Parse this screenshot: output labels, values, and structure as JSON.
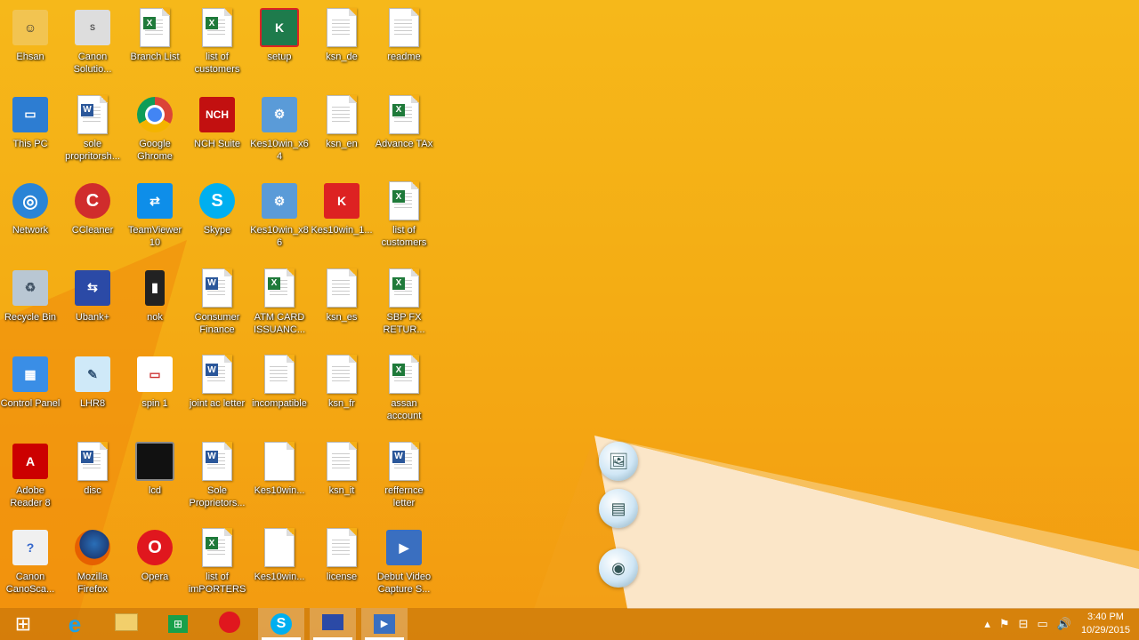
{
  "desktop": {
    "icons": [
      {
        "label": "Ehsan",
        "icon": "user-folder-icon"
      },
      {
        "label": "Canon Solutio...",
        "icon": "canon-solution-icon"
      },
      {
        "label": "Branch List",
        "icon": "excel-file-icon"
      },
      {
        "label": "list of customers",
        "icon": "excel-file-icon"
      },
      {
        "label": "setup",
        "icon": "kaspersky-setup-icon"
      },
      {
        "label": "ksn_de",
        "icon": "text-file-icon"
      },
      {
        "label": "readme",
        "icon": "text-file-icon"
      },
      {
        "label": "This PC",
        "icon": "computer-icon"
      },
      {
        "label": "sole propritorsh...",
        "icon": "word-file-icon"
      },
      {
        "label": "Google Ghrome",
        "icon": "chrome-icon"
      },
      {
        "label": "NCH Suite",
        "icon": "nch-icon"
      },
      {
        "label": "Kes10win_x64",
        "icon": "installer-icon"
      },
      {
        "label": "ksn_en",
        "icon": "text-file-icon"
      },
      {
        "label": "Advance TAx",
        "icon": "excel-file-icon"
      },
      {
        "label": "Network",
        "icon": "network-icon"
      },
      {
        "label": "CCleaner",
        "icon": "ccleaner-icon"
      },
      {
        "label": "TeamViewer 10",
        "icon": "teamviewer-icon"
      },
      {
        "label": "Skype",
        "icon": "skype-icon"
      },
      {
        "label": "Kes10win_x86",
        "icon": "installer-icon"
      },
      {
        "label": "Kes10win_1...",
        "icon": "kaspersky-icon"
      },
      {
        "label": "list of customers",
        "icon": "excel-file-icon"
      },
      {
        "label": "Recycle Bin",
        "icon": "recycle-bin-icon"
      },
      {
        "label": "Ubank+",
        "icon": "ubank-icon"
      },
      {
        "label": "nok",
        "icon": "phone-icon"
      },
      {
        "label": "Consumer Finance",
        "icon": "word-file-icon"
      },
      {
        "label": "ATM CARD ISSUANC...",
        "icon": "excel-file-icon"
      },
      {
        "label": "ksn_es",
        "icon": "text-file-icon"
      },
      {
        "label": "SBP FX RETUR...",
        "icon": "excel-file-icon"
      },
      {
        "label": "Control Panel",
        "icon": "control-panel-icon"
      },
      {
        "label": "LHR8",
        "icon": "notepad-icon"
      },
      {
        "label": "spin 1",
        "icon": "image-file-icon"
      },
      {
        "label": "joint ac letter",
        "icon": "word-file-icon"
      },
      {
        "label": "incompatible",
        "icon": "text-file-icon"
      },
      {
        "label": "ksn_fr",
        "icon": "text-file-icon"
      },
      {
        "label": "assan account",
        "icon": "excel-file-icon"
      },
      {
        "label": "Adobe Reader 8",
        "icon": "adobe-reader-icon"
      },
      {
        "label": "disc",
        "icon": "word-file-icon"
      },
      {
        "label": "lcd",
        "icon": "monitor-icon"
      },
      {
        "label": "Sole Proprietors...",
        "icon": "word-file-icon"
      },
      {
        "label": "Kes10win...",
        "icon": "blank-file-icon"
      },
      {
        "label": "ksn_it",
        "icon": "text-file-icon"
      },
      {
        "label": "reffernce letter",
        "icon": "word-file-icon"
      },
      {
        "label": "Canon CanoSca...",
        "icon": "canon-scan-icon"
      },
      {
        "label": "Mozilla Firefox",
        "icon": "firefox-icon"
      },
      {
        "label": "Opera",
        "icon": "opera-icon"
      },
      {
        "label": "list of imPORTERS",
        "icon": "excel-file-icon"
      },
      {
        "label": "Kes10win...",
        "icon": "blank-file-icon"
      },
      {
        "label": "license",
        "icon": "text-file-icon"
      },
      {
        "label": "Debut Video Capture S...",
        "icon": "debut-video-icon"
      }
    ]
  },
  "taskbar": {
    "items": [
      {
        "icon": "windows-start-icon",
        "active": false
      },
      {
        "icon": "internet-explorer-icon",
        "active": false
      },
      {
        "icon": "file-explorer-icon",
        "active": false
      },
      {
        "icon": "windows-store-icon",
        "active": false
      },
      {
        "icon": "opera-icon",
        "active": false
      },
      {
        "icon": "skype-icon",
        "active": true
      },
      {
        "icon": "remote-desktop-icon",
        "active": true
      },
      {
        "icon": "debut-video-icon",
        "active": true
      }
    ],
    "clock": {
      "time": "3:40 PM",
      "date": "10/29/2015"
    }
  },
  "colors": {
    "wallpaper": "#f5b01a",
    "taskbar": "#c0700c"
  }
}
